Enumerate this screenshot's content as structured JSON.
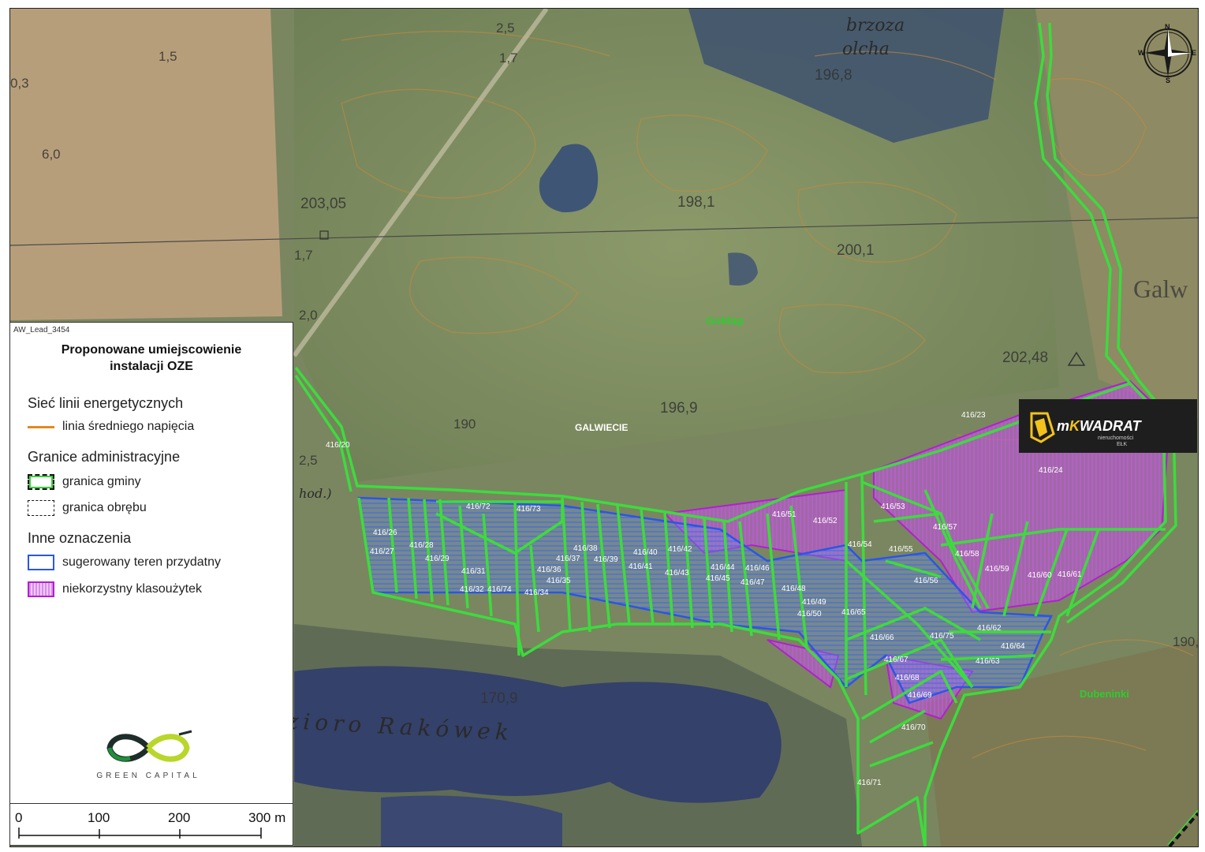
{
  "legend": {
    "lead": "AW_Lead_3454",
    "title_line1": "Proponowane umiejscowienie",
    "title_line2": "instalacji OZE",
    "section_energy": "Sieć linii energetycznych",
    "item_line": "linia średniego napięcia",
    "section_admin": "Granice administracyjne",
    "item_gmina": "granica gminy",
    "item_obreb": "granica obrębu",
    "section_other": "Inne oznaczenia",
    "item_teren": "sugerowany teren przydatny",
    "item_klasa": "niekorzystny klasoużytek"
  },
  "logo": {
    "text": "GREEN CAPITAL"
  },
  "scale": {
    "labels": [
      "0",
      "100",
      "200",
      "300 m"
    ]
  },
  "brand": {
    "name_prefix": "m",
    "name_k": "K",
    "name_rest": "WADRAT",
    "subtitle": "nieruchomości",
    "city": "EŁK"
  },
  "compass": {
    "n": "N",
    "s": "S",
    "e": "E",
    "w": "W"
  },
  "places": {
    "goldap": "Gołdap",
    "galwiecie": "GALWIECIE",
    "dubeninki": "Dubeninki",
    "galw_edge": "Galw",
    "lake": "zioro Rakówek",
    "olcha": "olcha",
    "brzoza": "brzoza",
    "chod": "hod.)"
  },
  "elevations": [
    "203,05",
    "198,1",
    "200,1",
    "202,48",
    "196,9",
    "196,8",
    "170,9",
    "190",
    "190,",
    "1,7",
    "2,0",
    "2,5",
    "1,5",
    "0,3",
    "6,0",
    "2,5",
    "1,7"
  ],
  "colors": {
    "boundary": "#3ddb3d",
    "teren": "#2a56e8",
    "klasa": "#b21fd0",
    "power": "#e08a1e"
  },
  "parcels": [
    {
      "id": "416/20"
    },
    {
      "id": "416/23"
    },
    {
      "id": "416/24"
    },
    {
      "id": "416/26"
    },
    {
      "id": "416/27"
    },
    {
      "id": "416/28"
    },
    {
      "id": "416/29"
    },
    {
      "id": "416/31"
    },
    {
      "id": "416/32"
    },
    {
      "id": "416/74"
    },
    {
      "id": "416/34"
    },
    {
      "id": "416/35"
    },
    {
      "id": "416/36"
    },
    {
      "id": "416/37"
    },
    {
      "id": "416/38"
    },
    {
      "id": "416/39"
    },
    {
      "id": "416/40"
    },
    {
      "id": "416/41"
    },
    {
      "id": "416/42"
    },
    {
      "id": "416/43"
    },
    {
      "id": "416/44"
    },
    {
      "id": "416/45"
    },
    {
      "id": "416/46"
    },
    {
      "id": "416/47"
    },
    {
      "id": "416/48"
    },
    {
      "id": "416/49"
    },
    {
      "id": "416/50"
    },
    {
      "id": "416/51"
    },
    {
      "id": "416/52"
    },
    {
      "id": "416/53"
    },
    {
      "id": "416/54"
    },
    {
      "id": "416/55"
    },
    {
      "id": "416/56"
    },
    {
      "id": "416/57"
    },
    {
      "id": "416/58"
    },
    {
      "id": "416/59"
    },
    {
      "id": "416/60"
    },
    {
      "id": "416/61"
    },
    {
      "id": "416/62"
    },
    {
      "id": "416/63"
    },
    {
      "id": "416/64"
    },
    {
      "id": "416/65"
    },
    {
      "id": "416/66"
    },
    {
      "id": "416/67"
    },
    {
      "id": "416/68"
    },
    {
      "id": "416/69"
    },
    {
      "id": "416/70"
    },
    {
      "id": "416/71"
    },
    {
      "id": "416/72"
    },
    {
      "id": "416/73"
    },
    {
      "id": "416/75"
    }
  ]
}
